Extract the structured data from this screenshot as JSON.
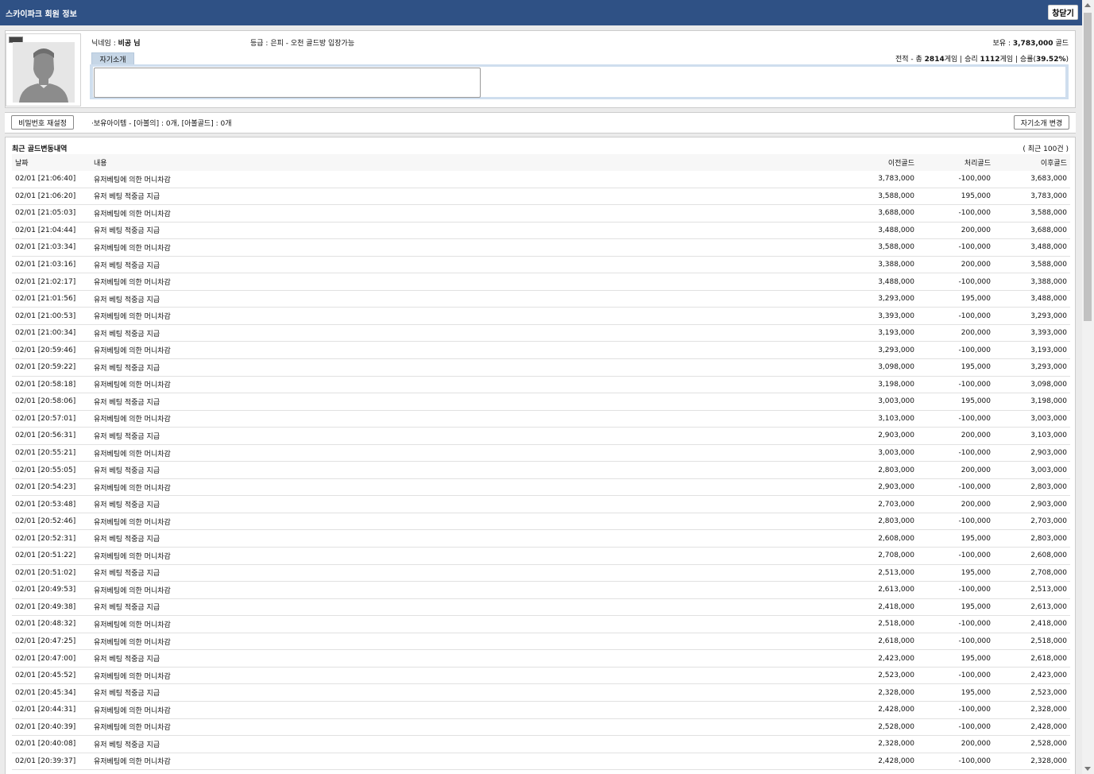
{
  "window": {
    "title": "스카이파크 회원 정보",
    "close_label": "창닫기"
  },
  "profile": {
    "nickname_label": "닉네임 :",
    "nickname": "비공 님",
    "grade_label": "등급 :",
    "grade": "은피 - 오천 골드방 입장가능",
    "holdings_label": "보유 :",
    "holdings": "3,783,000",
    "holdings_unit": "골드",
    "record_label": "전적 - 총",
    "total_games": "2814",
    "games_unit": "게임",
    "wins_label": "| 승리",
    "wins": "1112",
    "wins_unit": "게임",
    "winrate_label": "| 승률(",
    "winrate": "39.52%",
    "winrate_close": ")",
    "intro_tab": "자기소개",
    "intro_text": ""
  },
  "actions": {
    "reset_password": "비밀번호 재설정",
    "held_items": "·보유아이템 - [아볼의] : 0개, [아볼골드] : 0개",
    "edit_intro": "자기소개 변경"
  },
  "history": {
    "title": "최근 골드변동내역",
    "count_note": "( 최근 100건 )",
    "columns": {
      "date": "날짜",
      "desc": "내용",
      "prev": "이전골드",
      "change": "처리골드",
      "post": "이후골드"
    },
    "rows": [
      {
        "date": "02/01 [21:06:40]",
        "desc": "유저베팅에 의한 머니차감",
        "prev": "3,783,000",
        "change": "-100,000",
        "post": "3,683,000"
      },
      {
        "date": "02/01 [21:06:20]",
        "desc": "유저 베팅 적중금 지급",
        "prev": "3,588,000",
        "change": "195,000",
        "post": "3,783,000"
      },
      {
        "date": "02/01 [21:05:03]",
        "desc": "유저베팅에 의한 머니차감",
        "prev": "3,688,000",
        "change": "-100,000",
        "post": "3,588,000"
      },
      {
        "date": "02/01 [21:04:44]",
        "desc": "유저 베팅 적중금 지급",
        "prev": "3,488,000",
        "change": "200,000",
        "post": "3,688,000"
      },
      {
        "date": "02/01 [21:03:34]",
        "desc": "유저베팅에 의한 머니차감",
        "prev": "3,588,000",
        "change": "-100,000",
        "post": "3,488,000"
      },
      {
        "date": "02/01 [21:03:16]",
        "desc": "유저 베팅 적중금 지급",
        "prev": "3,388,000",
        "change": "200,000",
        "post": "3,588,000"
      },
      {
        "date": "02/01 [21:02:17]",
        "desc": "유저베팅에 의한 머니차감",
        "prev": "3,488,000",
        "change": "-100,000",
        "post": "3,388,000"
      },
      {
        "date": "02/01 [21:01:56]",
        "desc": "유저 베팅 적중금 지급",
        "prev": "3,293,000",
        "change": "195,000",
        "post": "3,488,000"
      },
      {
        "date": "02/01 [21:00:53]",
        "desc": "유저베팅에 의한 머니차감",
        "prev": "3,393,000",
        "change": "-100,000",
        "post": "3,293,000"
      },
      {
        "date": "02/01 [21:00:34]",
        "desc": "유저 베팅 적중금 지급",
        "prev": "3,193,000",
        "change": "200,000",
        "post": "3,393,000"
      },
      {
        "date": "02/01 [20:59:46]",
        "desc": "유저베팅에 의한 머니차감",
        "prev": "3,293,000",
        "change": "-100,000",
        "post": "3,193,000"
      },
      {
        "date": "02/01 [20:59:22]",
        "desc": "유저 베팅 적중금 지급",
        "prev": "3,098,000",
        "change": "195,000",
        "post": "3,293,000"
      },
      {
        "date": "02/01 [20:58:18]",
        "desc": "유저베팅에 의한 머니차감",
        "prev": "3,198,000",
        "change": "-100,000",
        "post": "3,098,000"
      },
      {
        "date": "02/01 [20:58:06]",
        "desc": "유저 베팅 적중금 지급",
        "prev": "3,003,000",
        "change": "195,000",
        "post": "3,198,000"
      },
      {
        "date": "02/01 [20:57:01]",
        "desc": "유저베팅에 의한 머니차감",
        "prev": "3,103,000",
        "change": "-100,000",
        "post": "3,003,000"
      },
      {
        "date": "02/01 [20:56:31]",
        "desc": "유저 베팅 적중금 지급",
        "prev": "2,903,000",
        "change": "200,000",
        "post": "3,103,000"
      },
      {
        "date": "02/01 [20:55:21]",
        "desc": "유저베팅에 의한 머니차감",
        "prev": "3,003,000",
        "change": "-100,000",
        "post": "2,903,000"
      },
      {
        "date": "02/01 [20:55:05]",
        "desc": "유저 베팅 적중금 지급",
        "prev": "2,803,000",
        "change": "200,000",
        "post": "3,003,000"
      },
      {
        "date": "02/01 [20:54:23]",
        "desc": "유저베팅에 의한 머니차감",
        "prev": "2,903,000",
        "change": "-100,000",
        "post": "2,803,000"
      },
      {
        "date": "02/01 [20:53:48]",
        "desc": "유저 베팅 적중금 지급",
        "prev": "2,703,000",
        "change": "200,000",
        "post": "2,903,000"
      },
      {
        "date": "02/01 [20:52:46]",
        "desc": "유저베팅에 의한 머니차감",
        "prev": "2,803,000",
        "change": "-100,000",
        "post": "2,703,000"
      },
      {
        "date": "02/01 [20:52:31]",
        "desc": "유저 베팅 적중금 지급",
        "prev": "2,608,000",
        "change": "195,000",
        "post": "2,803,000"
      },
      {
        "date": "02/01 [20:51:22]",
        "desc": "유저베팅에 의한 머니차감",
        "prev": "2,708,000",
        "change": "-100,000",
        "post": "2,608,000"
      },
      {
        "date": "02/01 [20:51:02]",
        "desc": "유저 베팅 적중금 지급",
        "prev": "2,513,000",
        "change": "195,000",
        "post": "2,708,000"
      },
      {
        "date": "02/01 [20:49:53]",
        "desc": "유저베팅에 의한 머니차감",
        "prev": "2,613,000",
        "change": "-100,000",
        "post": "2,513,000"
      },
      {
        "date": "02/01 [20:49:38]",
        "desc": "유저 베팅 적중금 지급",
        "prev": "2,418,000",
        "change": "195,000",
        "post": "2,613,000"
      },
      {
        "date": "02/01 [20:48:32]",
        "desc": "유저베팅에 의한 머니차감",
        "prev": "2,518,000",
        "change": "-100,000",
        "post": "2,418,000"
      },
      {
        "date": "02/01 [20:47:25]",
        "desc": "유저베팅에 의한 머니차감",
        "prev": "2,618,000",
        "change": "-100,000",
        "post": "2,518,000"
      },
      {
        "date": "02/01 [20:47:00]",
        "desc": "유저 베팅 적중금 지급",
        "prev": "2,423,000",
        "change": "195,000",
        "post": "2,618,000"
      },
      {
        "date": "02/01 [20:45:52]",
        "desc": "유저베팅에 의한 머니차감",
        "prev": "2,523,000",
        "change": "-100,000",
        "post": "2,423,000"
      },
      {
        "date": "02/01 [20:45:34]",
        "desc": "유저 베팅 적중금 지급",
        "prev": "2,328,000",
        "change": "195,000",
        "post": "2,523,000"
      },
      {
        "date": "02/01 [20:44:31]",
        "desc": "유저베팅에 의한 머니차감",
        "prev": "2,428,000",
        "change": "-100,000",
        "post": "2,328,000"
      },
      {
        "date": "02/01 [20:40:39]",
        "desc": "유저베팅에 의한 머니차감",
        "prev": "2,528,000",
        "change": "-100,000",
        "post": "2,428,000"
      },
      {
        "date": "02/01 [20:40:08]",
        "desc": "유저 베팅 적중금 지급",
        "prev": "2,328,000",
        "change": "200,000",
        "post": "2,528,000"
      },
      {
        "date": "02/01 [20:39:37]",
        "desc": "유저베팅에 의한 머니차감",
        "prev": "2,428,000",
        "change": "-100,000",
        "post": "2,328,000"
      }
    ]
  }
}
